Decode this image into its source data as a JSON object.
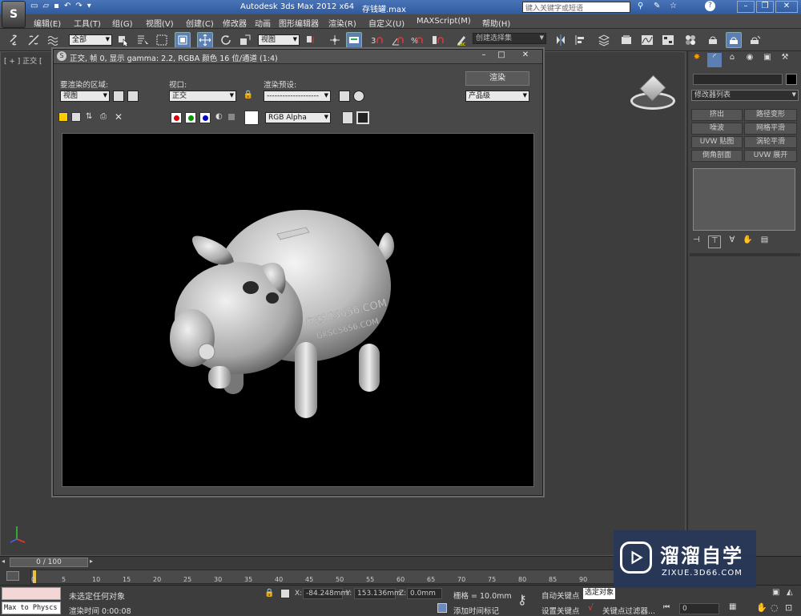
{
  "title_bar": {
    "app_title": "Autodesk 3ds Max  2012 x64",
    "file_name": "存钱罐.max",
    "search_placeholder": "键入关键字或短语"
  },
  "menu": {
    "items": [
      "编辑(E)",
      "工具(T)",
      "组(G)",
      "视图(V)",
      "创建(C)",
      "修改器",
      "动画",
      "图形编辑器",
      "渲染(R)",
      "自定义(U)",
      "MAXScript(M)",
      "帮助(H)"
    ]
  },
  "toolbar": {
    "selection_filter": "全部",
    "ref_coord": "视图",
    "named_selection": "创建选择集"
  },
  "viewport": {
    "label": "[ + ] 正交 ["
  },
  "render_frame": {
    "title": "正交, 帧 0, 显示 gamma: 2.2, RGBA 颜色 16 位/通道 (1:4)",
    "area_label": "要渲染的区域:",
    "area_value": "视图",
    "viewport_label": "视口:",
    "viewport_value": "正交",
    "preset_label": "渲染预设:",
    "preset_value": "--------------------",
    "render_button": "渲染",
    "quality_value": "产品级",
    "channel_value": "RGB Alpha",
    "emboss_line1": "GKSC5656.COM",
    "emboss_line2": "GKSC5656.COM"
  },
  "command_panel": {
    "modifier_list": "修改器列表",
    "buttons": [
      "挤出",
      "路径变形",
      "噪波",
      "网格平滑",
      "UVW 贴图",
      "涡轮平滑",
      "倒角剖面",
      "UVW 展开"
    ]
  },
  "timeline": {
    "frame_display": "0 / 100",
    "ticks": [
      "0",
      "5",
      "10",
      "15",
      "20",
      "25",
      "30",
      "35",
      "40",
      "45",
      "50",
      "55",
      "60",
      "65",
      "70",
      "75",
      "80",
      "85",
      "90"
    ]
  },
  "status": {
    "script_field": "Max to Physcs (",
    "message": "未选定任何对象",
    "render_time": "渲染时间  0:00:08",
    "x_label": "X:",
    "x_value": "-84.248mm",
    "y_label": "Y:",
    "y_value": "153.136mm",
    "z_label": "Z:",
    "z_value": "0.0mm",
    "grid": "栅格 = 10.0mm",
    "add_time_tag": "添加时间标记",
    "auto_key": "自动关键点",
    "selected": "选定对象",
    "set_key": "设置关键点",
    "key_filters": "关键点过滤器...",
    "frame_field": "0"
  },
  "watermark": {
    "brand": "溜溜自学",
    "url": "ZIXUE.3D66.COM"
  },
  "colors": {
    "title_blue": "#3a66ad",
    "ui_dark": "#444444",
    "render_bg": "#000000",
    "watermark_bg": "#28375a"
  }
}
